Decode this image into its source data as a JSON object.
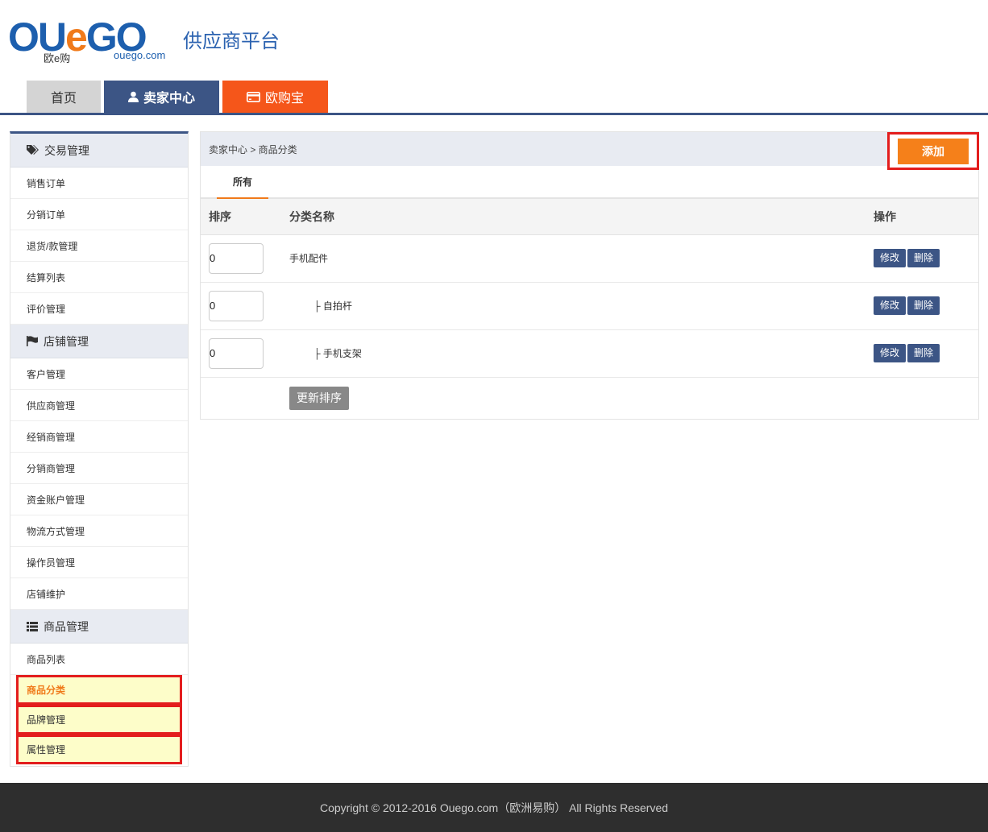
{
  "header": {
    "logo_text": "OUeGO",
    "logo_subtext": "欧e购",
    "logo_domain": "ouego.com",
    "platform_title": "供应商平台"
  },
  "nav": {
    "home": "首页",
    "seller_center": "卖家中心",
    "ouego_pay": "欧购宝"
  },
  "sidebar": {
    "groups": [
      {
        "title": "交易管理",
        "icon": "tags-icon",
        "items": [
          "销售订单",
          "分销订单",
          "退货/款管理",
          "结算列表",
          "评价管理"
        ]
      },
      {
        "title": "店铺管理",
        "icon": "flag-icon",
        "items": [
          "客户管理",
          "供应商管理",
          "经销商管理",
          "分销商管理",
          "资金账户管理",
          "物流方式管理",
          "操作员管理",
          "店铺维护"
        ]
      },
      {
        "title": "商品管理",
        "icon": "list-icon",
        "items": [
          "商品列表",
          "商品分类",
          "品牌管理",
          "属性管理"
        ]
      }
    ]
  },
  "breadcrumb": "卖家中心 > 商品分类",
  "add_button": "添加",
  "tab_all": "所有",
  "table": {
    "headers": [
      "排序",
      "分类名称",
      "操作"
    ],
    "rows": [
      {
        "order": "0",
        "name": "手机配件",
        "indent": false
      },
      {
        "order": "0",
        "name": "├ 自拍杆",
        "indent": true
      },
      {
        "order": "0",
        "name": "├ 手机支架",
        "indent": true
      }
    ],
    "edit_label": "修改",
    "delete_label": "删除"
  },
  "update_order_button": "更新排序",
  "footer": {
    "copyright": "Copyright © 2012-2016 Ouego.com（欧洲易购） All Rights Reserved"
  },
  "colors": {
    "navy": "#3c5585",
    "orange": "#f5801a",
    "highlight_border": "#e31d1d"
  }
}
